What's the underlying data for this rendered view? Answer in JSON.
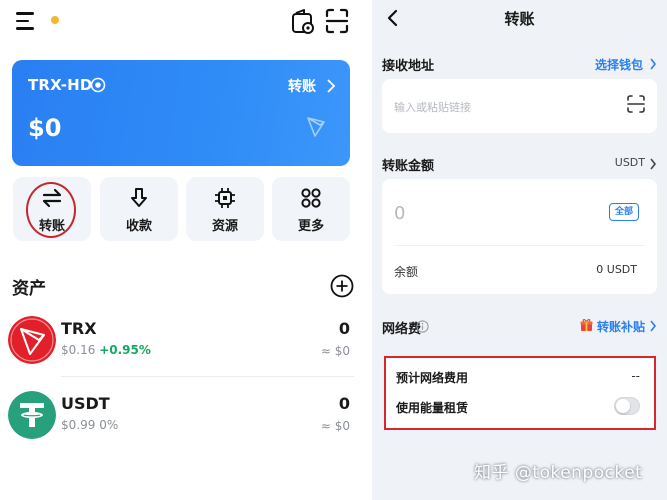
{
  "left": {
    "wallet": {
      "name": "TRX-HD",
      "transfer_label": "转账",
      "balance": "$0"
    },
    "actions": [
      {
        "label": "转账"
      },
      {
        "label": "收款"
      },
      {
        "label": "资源"
      },
      {
        "label": "更多"
      }
    ],
    "assets_title": "资产",
    "assets": [
      {
        "symbol": "TRX",
        "price": "$0.16",
        "change": "+0.95%",
        "amount": "0",
        "value": "≈ $0"
      },
      {
        "symbol": "USDT",
        "price": "$0.99",
        "change": "0%",
        "amount": "0",
        "value": "≈ $0"
      }
    ]
  },
  "right": {
    "title": "转账",
    "recipient": {
      "label": "接收地址",
      "link": "选择钱包",
      "placeholder": "输入或粘贴链接"
    },
    "amount": {
      "label": "转账金额",
      "unit": "USDT",
      "placeholder": "0",
      "all_label": "全部",
      "balance_label": "余额",
      "balance_value": "0 USDT"
    },
    "fee": {
      "label": "网络费",
      "link": "转账补贴",
      "estimated_label": "预计网络费用",
      "estimated_value": "--",
      "energy_label": "使用能量租赁",
      "energy_enabled": false
    },
    "watermark": "知乎 @tokenpocket"
  },
  "colors": {
    "accent": "#2a7ff2",
    "highlight_red": "#d8262e",
    "positive": "#1aa563",
    "tron_red": "#e3202a",
    "tether_green": "#26a17b",
    "status_dot": "#f3b634"
  }
}
